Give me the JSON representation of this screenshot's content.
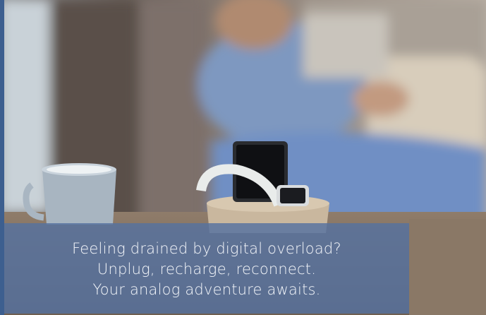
{
  "caption": {
    "line1": "Feeling drained by digital overload?",
    "line2": "Unplug, recharge, reconnect.",
    "line3": "Your analog adventure awaits."
  },
  "colors": {
    "overlay": "#5672a0",
    "accent_bar": "#3d5f8f",
    "caption_text": "#f4f7fb"
  }
}
